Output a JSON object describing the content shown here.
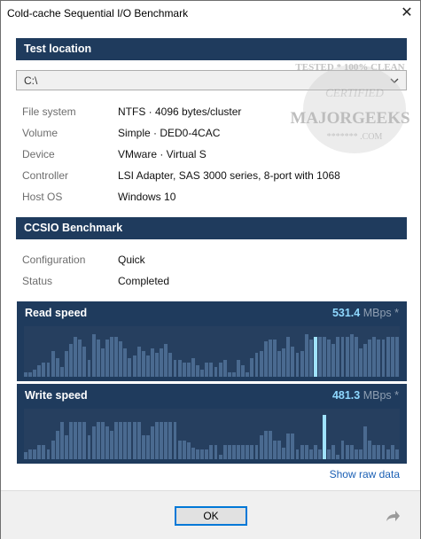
{
  "window": {
    "title": "Cold-cache Sequential I/O Benchmark",
    "close_glyph": "✕"
  },
  "location": {
    "header": "Test location",
    "drive": "C:\\",
    "rows": [
      {
        "label": "File system",
        "value": "NTFS · 4096 bytes/cluster"
      },
      {
        "label": "Volume",
        "value": "Simple · DED0-4CAC"
      },
      {
        "label": "Device",
        "value": "VMware · Virtual S"
      },
      {
        "label": "Controller",
        "value": "LSI Adapter, SAS 3000 series, 8-port with 1068"
      },
      {
        "label": "Host OS",
        "value": "Windows 10"
      }
    ]
  },
  "benchmark": {
    "header": "CCSIO Benchmark",
    "rows": [
      {
        "label": "Configuration",
        "value": "Quick"
      },
      {
        "label": "Status",
        "value": "Completed"
      }
    ]
  },
  "charts": {
    "read": {
      "title": "Read speed",
      "value": "531.4",
      "unit": "MBps *",
      "bars": [
        0.1,
        0.1,
        0.15,
        0.25,
        0.3,
        0.3,
        0.55,
        0.4,
        0.2,
        0.55,
        0.7,
        0.85,
        0.8,
        0.65,
        0.35,
        0.9,
        0.8,
        0.6,
        0.8,
        0.85,
        0.85,
        0.75,
        0.6,
        0.4,
        0.45,
        0.65,
        0.55,
        0.45,
        0.6,
        0.5,
        0.6,
        0.7,
        0.5,
        0.35,
        0.35,
        0.3,
        0.3,
        0.4,
        0.25,
        0.15,
        0.3,
        0.3,
        0.2,
        0.3,
        0.35,
        0.1,
        0.1,
        0.35,
        0.25,
        0.1,
        0.4,
        0.5,
        0.55,
        0.75,
        0.8,
        0.8,
        0.55,
        0.6,
        0.85,
        0.65,
        0.5,
        0.55,
        0.9,
        0.8,
        0.85,
        0.85,
        0.85,
        0.8,
        0.7,
        0.85,
        0.85,
        0.85,
        0.9,
        0.85,
        0.6,
        0.7,
        0.8,
        0.85,
        0.8,
        0.8,
        0.85,
        0.85,
        0.85
      ],
      "highlight_index": 64
    },
    "write": {
      "title": "Write speed",
      "value": "481.3",
      "unit": "MBps *",
      "bars": [
        0.15,
        0.2,
        0.2,
        0.3,
        0.3,
        0.2,
        0.4,
        0.6,
        0.8,
        0.5,
        0.8,
        0.8,
        0.8,
        0.8,
        0.5,
        0.7,
        0.8,
        0.8,
        0.7,
        0.6,
        0.8,
        0.8,
        0.8,
        0.8,
        0.8,
        0.8,
        0.5,
        0.5,
        0.7,
        0.8,
        0.8,
        0.8,
        0.8,
        0.8,
        0.4,
        0.4,
        0.35,
        0.25,
        0.2,
        0.2,
        0.2,
        0.3,
        0.3,
        0.1,
        0.3,
        0.3,
        0.3,
        0.3,
        0.3,
        0.3,
        0.3,
        0.3,
        0.5,
        0.6,
        0.6,
        0.4,
        0.4,
        0.25,
        0.55,
        0.55,
        0.2,
        0.3,
        0.3,
        0.2,
        0.3,
        0.2,
        0.95,
        0.2,
        0.3,
        0.1,
        0.4,
        0.3,
        0.3,
        0.2,
        0.2,
        0.7,
        0.4,
        0.3,
        0.3,
        0.3,
        0.2,
        0.3,
        0.2
      ],
      "highlight_index": 66
    }
  },
  "show_raw_data": "Show raw data",
  "footer": {
    "ok_label": "OK"
  },
  "watermark": {
    "line1": "TESTED * 100% CLEAN",
    "line2": "CERTIFIED",
    "line3": "MAJORGEEKS",
    "line4": "******* .COM"
  },
  "colors": {
    "header_bg": "#1f3b5d",
    "bar": "#4a6a90",
    "bar_highlight": "#9fe2ff",
    "link": "#1a5fb4"
  }
}
